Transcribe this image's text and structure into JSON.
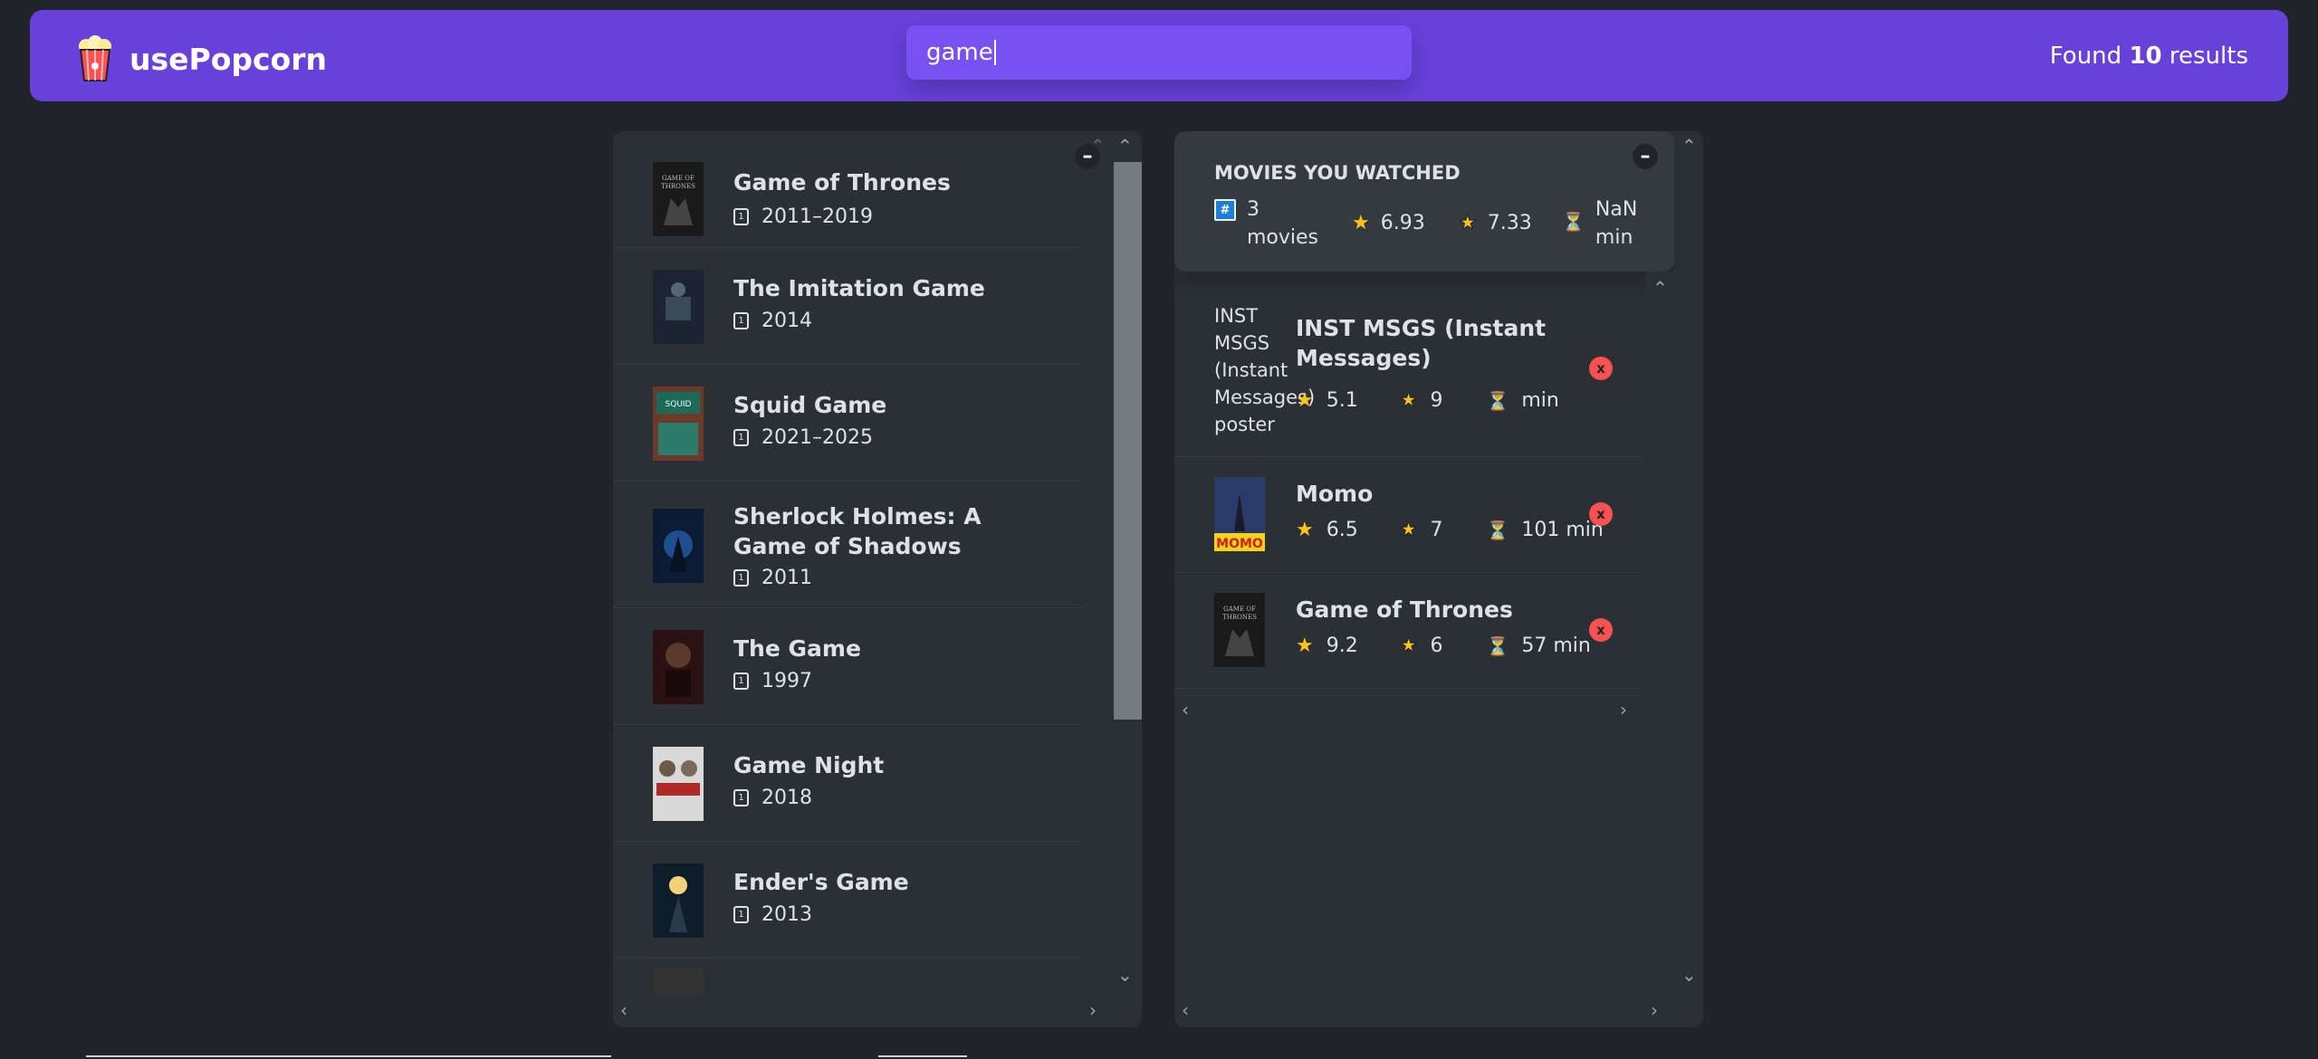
{
  "app": {
    "name": "usePopcorn"
  },
  "search": {
    "value": "game"
  },
  "results": {
    "prefix": "Found",
    "count": "10",
    "suffix": "results"
  },
  "search_list": {
    "toggle": "–",
    "movies": [
      {
        "title": "Game of Thrones",
        "year": "2011–2019"
      },
      {
        "title": "The Imitation Game",
        "year": "2014"
      },
      {
        "title": "Squid Game",
        "year": "2021–2025"
      },
      {
        "title": "Sherlock Holmes: A Game of Shadows",
        "year": "2011"
      },
      {
        "title": "The Game",
        "year": "1997"
      },
      {
        "title": "Game Night",
        "year": "2018"
      },
      {
        "title": "Ender's Game",
        "year": "2013"
      }
    ],
    "year_icon": "calendar-icon"
  },
  "watched": {
    "toggle": "–",
    "heading": "Movies you watched",
    "count": "3",
    "count_unit": "movies",
    "avg_imdb": "6.93",
    "avg_user": "7.33",
    "avg_runtime": "NaN",
    "runtime_unit": "min",
    "movies": [
      {
        "title": "INST MSGS (Instant Messages)",
        "poster_alt": "INST MSGS (Instant Messages) poster",
        "imdb": "5.1",
        "user": "9",
        "runtime": "min"
      },
      {
        "title": "Momo",
        "imdb": "6.5",
        "user": "7",
        "runtime": "101 min"
      },
      {
        "title": "Game of Thrones",
        "imdb": "9.2",
        "user": "6",
        "runtime": "57 min"
      }
    ],
    "delete_label": "x"
  },
  "colors": {
    "primary": "#6741d9",
    "primary_light": "#7950f2",
    "background": "#212529",
    "box": "#2b3035",
    "red": "#fa5252",
    "star": "#fcc419"
  }
}
